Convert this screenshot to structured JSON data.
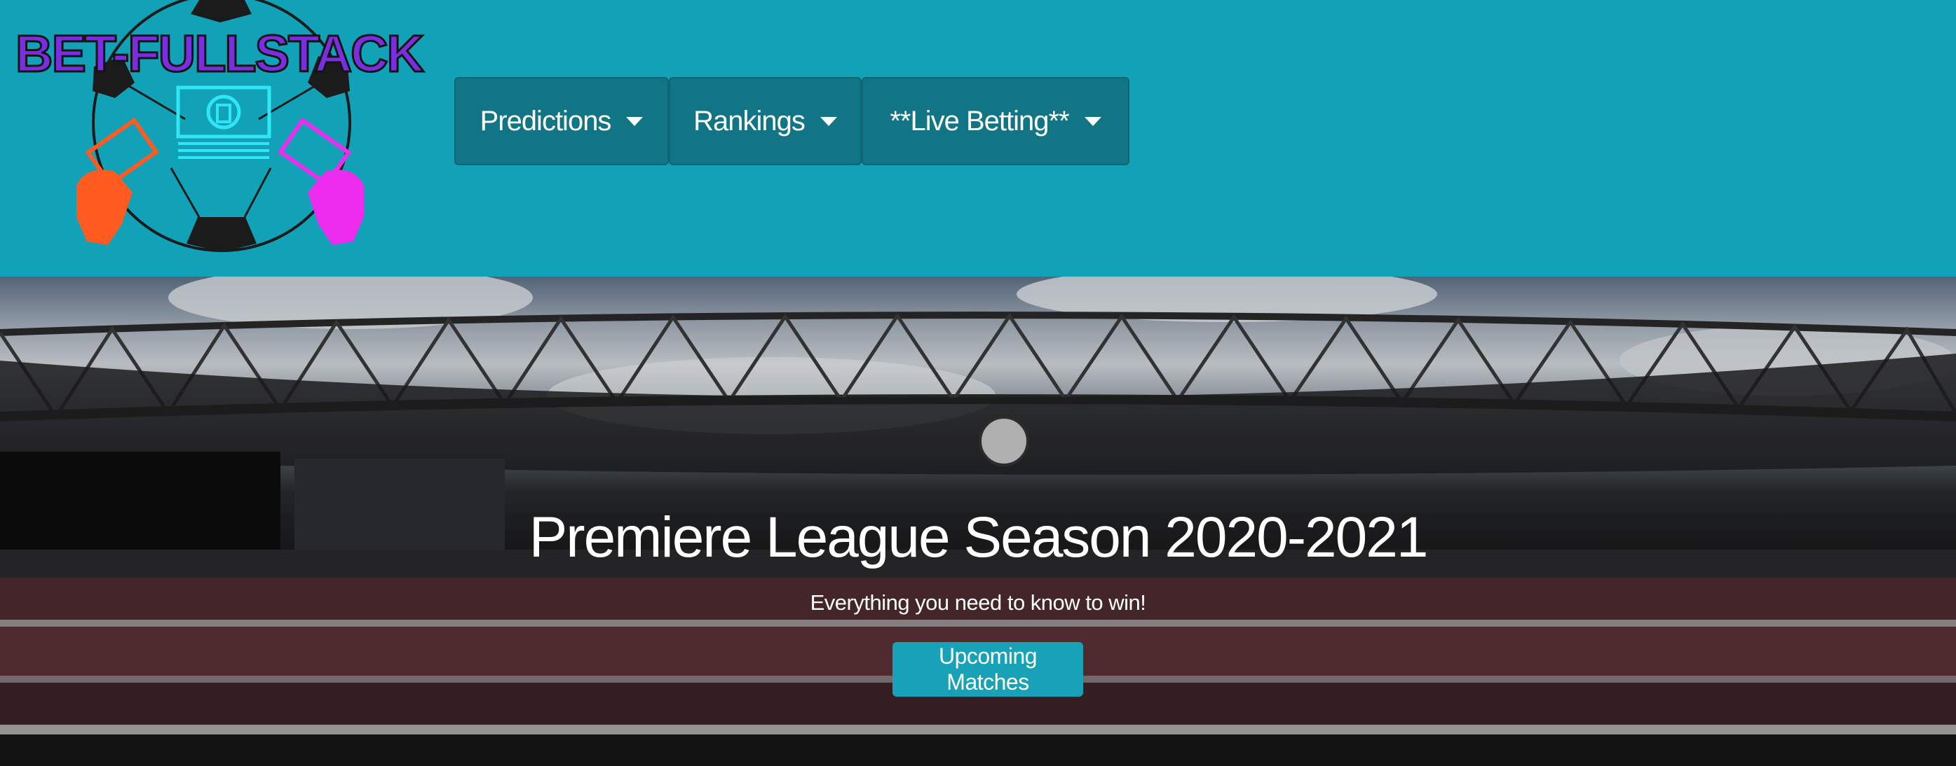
{
  "brand": {
    "name": "BET-FULLSTACK"
  },
  "nav": {
    "items": [
      {
        "label": "Predictions"
      },
      {
        "label": "Rankings"
      },
      {
        "label": "**Live Betting**"
      }
    ]
  },
  "hero": {
    "title": "Premiere League Season 2020-2021",
    "subtitle": "Everything you need to know to win!",
    "cta_label": "Upcoming Matches"
  },
  "colors": {
    "navbar_bg": "#12a2b8",
    "nav_button_bg": "#117585",
    "cta_bg": "#17a2b8",
    "logo_text": "#7a2ee0"
  },
  "icons": [
    "soccer-ball-logo-icon",
    "money-bill-icon",
    "hand-holding-money-icon",
    "caret-down-icon"
  ]
}
